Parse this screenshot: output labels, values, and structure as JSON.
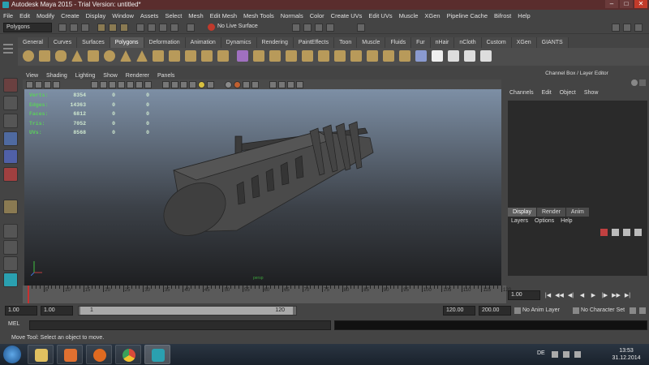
{
  "window": {
    "title": "Autodesk Maya 2015 - Trial Version: untitled*"
  },
  "menubar": {
    "items": [
      "File",
      "Edit",
      "Modify",
      "Create",
      "Display",
      "Window",
      "Assets",
      "Select",
      "Mesh",
      "Edit Mesh",
      "Mesh Tools",
      "Normals",
      "Color",
      "Create UVs",
      "Edit UVs",
      "Muscle",
      "XGen",
      "Pipeline Cache",
      "Bifrost",
      "Help"
    ]
  },
  "statusline": {
    "mode": "Polygons",
    "live_surface": "No Live Surface"
  },
  "shelf": {
    "tabs": [
      "General",
      "Curves",
      "Surfaces",
      "Polygons",
      "Deformation",
      "Animation",
      "Dynamics",
      "Rendering",
      "PaintEffects",
      "Toon",
      "Muscle",
      "Fluids",
      "Fur",
      "nHair",
      "nCloth",
      "Custom",
      "XGen",
      "GIANTS"
    ],
    "active_tab": "Polygons"
  },
  "panel": {
    "menu": [
      "View",
      "Shading",
      "Lighting",
      "Show",
      "Renderer",
      "Panels"
    ]
  },
  "viewport": {
    "stats": [
      {
        "label": "Verts:",
        "v1": "8354",
        "v2": "0",
        "v3": "0"
      },
      {
        "label": "Edges:",
        "v1": "14363",
        "v2": "0",
        "v3": "0"
      },
      {
        "label": "Faces:",
        "v1": "6812",
        "v2": "0",
        "v3": "0"
      },
      {
        "label": "Tris:",
        "v1": "7052",
        "v2": "0",
        "v3": "0"
      },
      {
        "label": "UVs:",
        "v1": "8568",
        "v2": "0",
        "v3": "0"
      }
    ],
    "camera_label": "persp"
  },
  "channelbox": {
    "title": "Channel Box / Layer Editor",
    "menu": [
      "Channels",
      "Edit",
      "Object",
      "Show"
    ],
    "layer_tabs": [
      "Display",
      "Render",
      "Anim"
    ],
    "active_layer_tab": "Display",
    "layer_menu": [
      "Layers",
      "Options",
      "Help"
    ]
  },
  "timeslider": {
    "ticks": [
      "5",
      "10",
      "15",
      "20",
      "25",
      "30",
      "35",
      "40",
      "45",
      "50",
      "55",
      "60",
      "65",
      "70",
      "75",
      "80",
      "85",
      "90",
      "95",
      "100",
      "105",
      "110",
      "115",
      "120"
    ],
    "current_frame": "1.00"
  },
  "playback": {
    "buttons": [
      "|◀",
      "◀◀",
      "◀|",
      "◀",
      "▶",
      "|▶",
      "▶▶",
      "▶|"
    ]
  },
  "range": {
    "start_time": "1.00",
    "playback_start": "1.00",
    "range_start_label": "1",
    "range_end_label": "120",
    "playback_end": "120.00",
    "end_time": "200.00",
    "anim_layer": "No Anim Layer",
    "character_set": "No Character Set"
  },
  "cmdline": {
    "label": "MEL"
  },
  "helpline": {
    "text": "Move Tool: Select an object to move."
  },
  "taskbar": {
    "language": "DE",
    "time": "13:53",
    "date": "31.12.2014"
  }
}
